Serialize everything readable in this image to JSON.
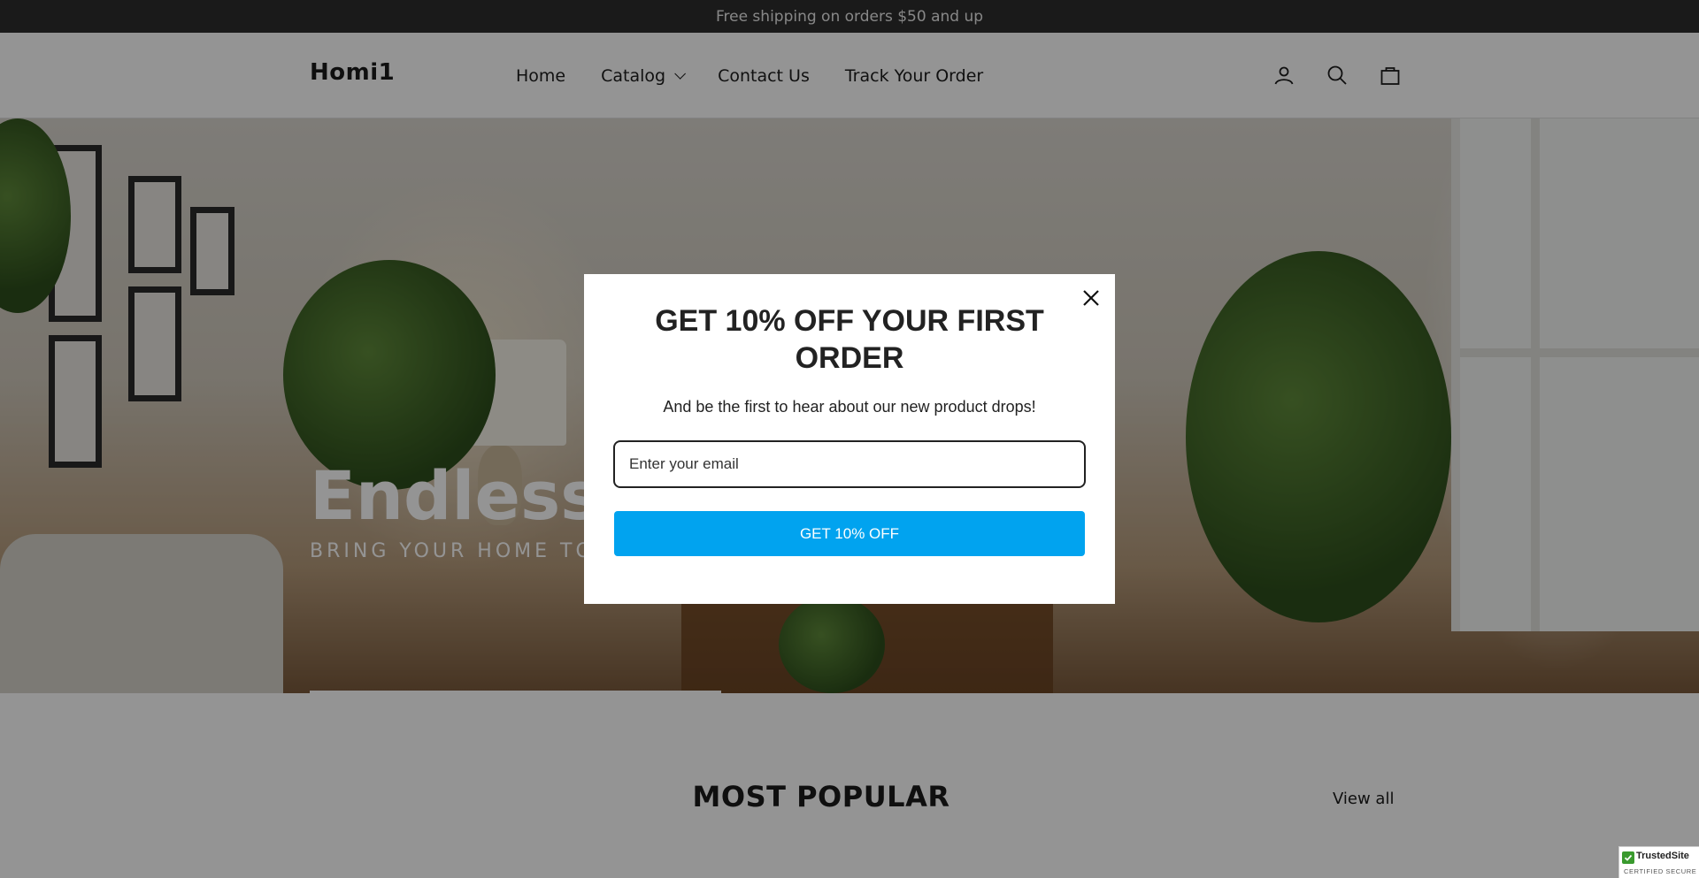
{
  "announcement": {
    "text": "Free shipping on orders $50 and up"
  },
  "header": {
    "logo": "Homi1",
    "nav": [
      {
        "label": "Home"
      },
      {
        "label": "Catalog",
        "has_dropdown": true
      },
      {
        "label": "Contact Us"
      },
      {
        "label": "Track Your Order"
      }
    ],
    "icons": [
      "account-icon",
      "search-icon",
      "cart-icon"
    ]
  },
  "hero": {
    "title": "Endless possibilit",
    "subtitle": "BRING YOUR HOME TO LIFE"
  },
  "section": {
    "title": "MOST POPULAR",
    "view_all": "View all"
  },
  "modal": {
    "title": "GET 10% OFF YOUR FIRST ORDER",
    "text": "And be the first to hear about our new product drops!",
    "email_placeholder": "Enter your email",
    "cta_label": "GET 10% OFF",
    "close_icon": "close-icon",
    "accent_color": "#01a3ef"
  },
  "trust_badge": {
    "name": "TrustedSite",
    "sub": "CERTIFIED SECURE"
  }
}
